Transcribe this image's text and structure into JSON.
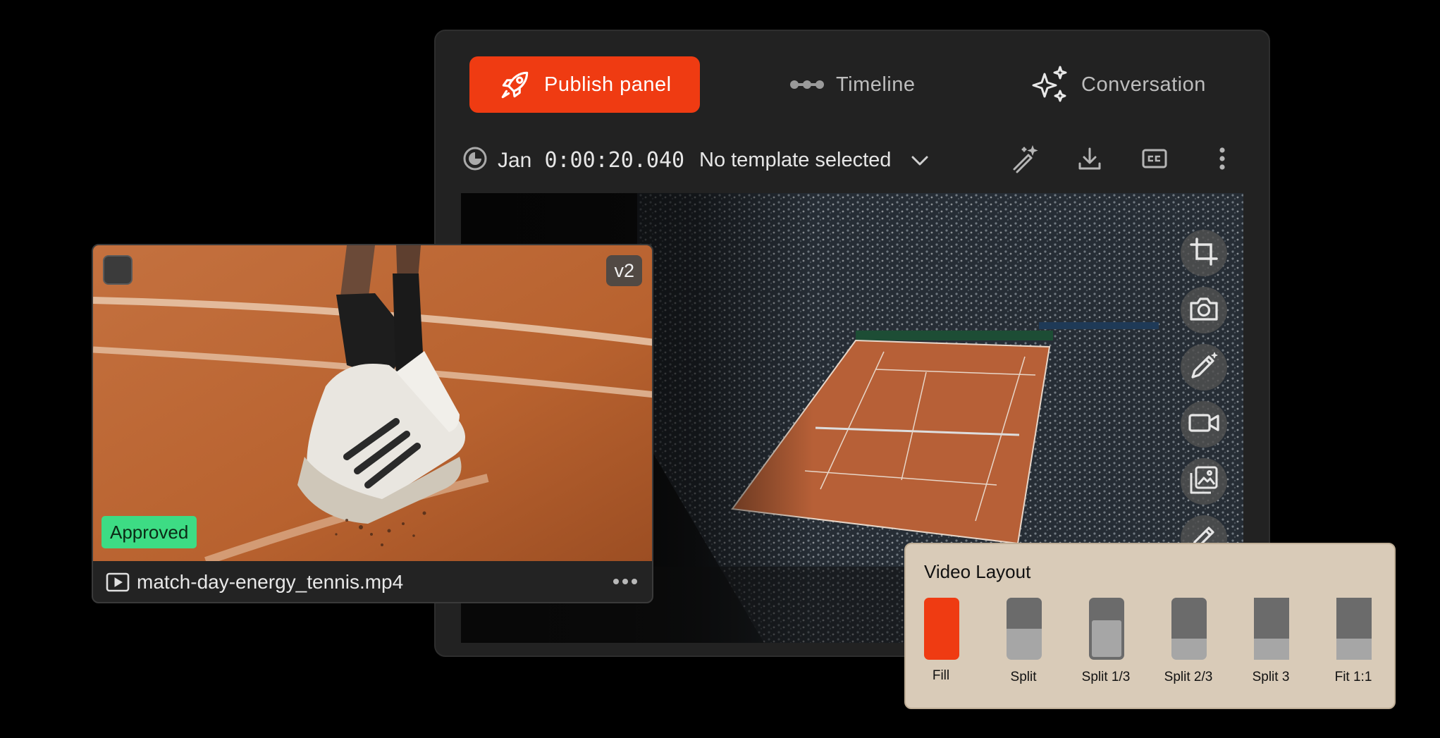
{
  "tabs": [
    {
      "label": "Publish panel",
      "icon": "rocket-icon",
      "active": true
    },
    {
      "label": "Timeline",
      "icon": "timeline-dots-icon",
      "active": false
    },
    {
      "label": "Conversation",
      "icon": "sparkles-icon",
      "active": false
    }
  ],
  "toolbar": {
    "month": "Jan",
    "timecode": "0:00:20.040",
    "template": "No template selected",
    "actions": [
      "magic-wand-icon",
      "download-icon",
      "closed-captions-icon",
      "more-vertical-icon"
    ]
  },
  "side_tools": [
    "crop-icon",
    "camera-icon",
    "pencil-icon",
    "video-camera-icon",
    "gallery-icon",
    "pencil-icon"
  ],
  "clip": {
    "version": "v2",
    "status": "Approved",
    "file_name": "match-day-energy_tennis.mp4"
  },
  "video_layout": {
    "title": "Video Layout",
    "options": [
      "Fill",
      "Split",
      "Split 1/3",
      "Split 2/3",
      "Split 3",
      "Fit 1:1"
    ],
    "selected": "Fill"
  },
  "colors": {
    "accent": "#ef3b12",
    "approved": "#3ddc84",
    "panel": "#222222",
    "popover": "#d9cbb8"
  }
}
